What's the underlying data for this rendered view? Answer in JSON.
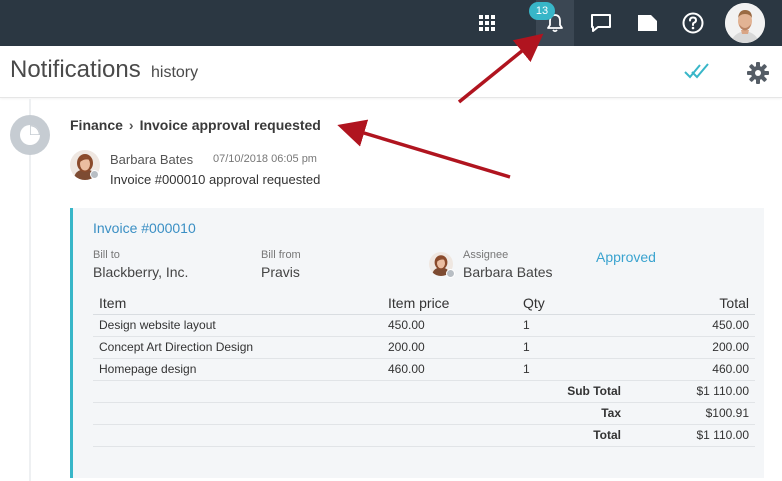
{
  "topbar": {
    "notification_count": "13",
    "icons": [
      "apps-grid-icon",
      "bell-icon",
      "chat-icon",
      "tag-icon",
      "help-icon"
    ],
    "bg_color": "#2b3742",
    "badge_color": "#38b6c8"
  },
  "header": {
    "title": "Notifications",
    "subtitle": "history"
  },
  "notification": {
    "breadcrumb": [
      "Finance",
      "Invoice approval requested"
    ],
    "author": "Barbara Bates",
    "timestamp": "07/10/2018 06:05 pm",
    "message": "Invoice #000010 approval requested",
    "invoice": {
      "title": "Invoice #000010",
      "bill_to_label": "Bill to",
      "bill_to": "Blackberry, Inc.",
      "bill_from_label": "Bill from",
      "bill_from": "Pravis",
      "assignee_label": "Assignee",
      "assignee": "Barbara Bates",
      "status": "Approved",
      "columns": [
        "Item",
        "Item price",
        "Qty",
        "Total"
      ],
      "rows": [
        {
          "item": "Design website layout",
          "price": "450.00",
          "qty": "1",
          "total": "450.00"
        },
        {
          "item": "Concept Art Direction Design",
          "price": "200.00",
          "qty": "1",
          "total": "200.00"
        },
        {
          "item": "Homepage design",
          "price": "460.00",
          "qty": "1",
          "total": "460.00"
        }
      ],
      "summary": [
        {
          "label": "Sub Total",
          "value": "$1 110.00"
        },
        {
          "label": "Tax",
          "value": "$100.91"
        },
        {
          "label": "Total",
          "value": "$1 110.00"
        }
      ],
      "accent_color": "#38b6c8"
    }
  },
  "annotations": {
    "arrow_color": "#b0141f"
  }
}
